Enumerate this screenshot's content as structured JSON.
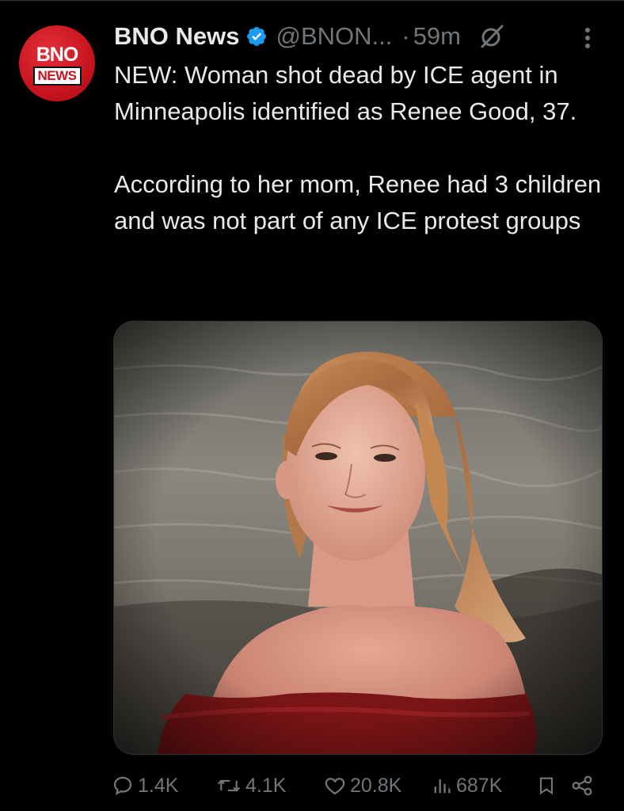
{
  "post": {
    "author": {
      "display_name": "BNO News",
      "handle": "@BNON...",
      "verified": true,
      "avatar": {
        "top_text": "BNO",
        "bottom_text": "NEWS",
        "color": "#c8141f"
      }
    },
    "separator": "·",
    "timestamp": "59m",
    "text_paragraphs": [
      "NEW: Woman shot dead by ICE agent in Minneapolis identified as Renee Good, 37.",
      "According to her mom, Renee had 3 children and was not part of any ICE protest groups"
    ],
    "media": {
      "type": "photo",
      "description": "Portrait of a smiling woman with wavy strawberry-blonde hair in an off-shoulder red top, sea in background"
    },
    "stats": {
      "replies": "1.4K",
      "reposts": "4.1K",
      "likes": "20.8K",
      "views": "687K"
    }
  },
  "icons": {
    "verified": "verified-badge-icon",
    "grok": "grok-icon",
    "more": "more-vertical-icon",
    "reply": "reply-icon",
    "repost": "repost-icon",
    "like": "heart-icon",
    "views": "views-chart-icon",
    "bookmark": "bookmark-icon",
    "share": "share-icon"
  },
  "colors": {
    "background": "#000000",
    "text_primary": "#e7e9ea",
    "text_secondary": "#71767b",
    "verified_blue": "#1d9bf0"
  }
}
